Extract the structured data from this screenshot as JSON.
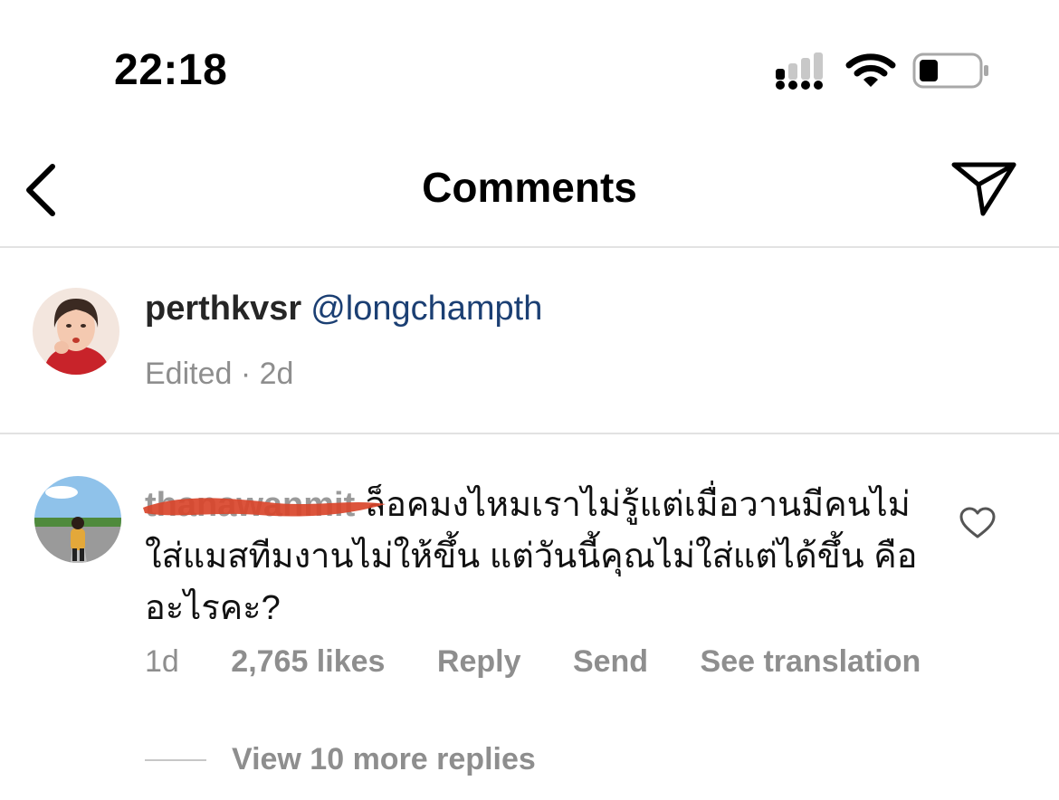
{
  "status_bar": {
    "time": "22:18",
    "icons": [
      "cellular-signal-icon",
      "wifi-icon",
      "battery-icon"
    ]
  },
  "nav": {
    "title": "Comments",
    "back_icon": "chevron-left-icon",
    "share_icon": "paper-plane-icon"
  },
  "caption": {
    "username": "perthkvsr",
    "mention": "@longchampth",
    "meta": "Edited · 2d"
  },
  "comment": {
    "username": "thanawanmit",
    "text": "ล็อคมงไหมเราไม่รู้แต่เมื่อวานมีคนไม่ใส่แมสทีมงานไม่ให้ขึ้น แต่วันนี้คุณไม่ใส่แต่ได้ขึ้น คืออะไรคะ?",
    "time": "1d",
    "likes": "2,765 likes",
    "reply_label": "Reply",
    "send_label": "Send",
    "translate_label": "See translation",
    "view_replies": "View 10 more replies"
  },
  "colors": {
    "mention": "#1b3f73",
    "meta_gray": "#8e8e8e",
    "redaction": "#d9452b",
    "divider": "#e2e2e2"
  }
}
